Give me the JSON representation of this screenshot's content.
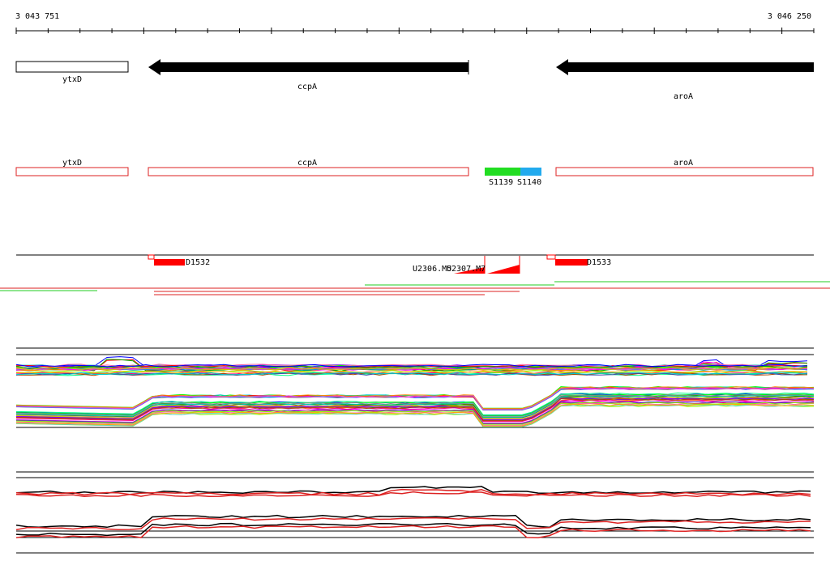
{
  "coordinates": {
    "start": "3 043 751",
    "end": "3 046 250"
  },
  "genes": [
    {
      "name": "ytxD",
      "strand": "none"
    },
    {
      "name": "ccpA",
      "strand": "minus"
    },
    {
      "name": "aroA",
      "strand": "minus"
    }
  ],
  "annotation_track": [
    {
      "name": "ytxD"
    },
    {
      "name": "ccpA"
    },
    {
      "name": "aroA"
    }
  ],
  "segments": [
    {
      "label": "S1139",
      "color": "#22dd22"
    },
    {
      "label": "S1140",
      "color": "#22aaee"
    }
  ],
  "features": [
    {
      "label": "D1532"
    },
    {
      "label": "U2306.M5"
    },
    {
      "label": "U2307.M7"
    },
    {
      "label": "D1533"
    }
  ],
  "colors": {
    "gene_arrow": "#000000",
    "annotation_box": "#dd2222",
    "feature": "#ff0000"
  }
}
